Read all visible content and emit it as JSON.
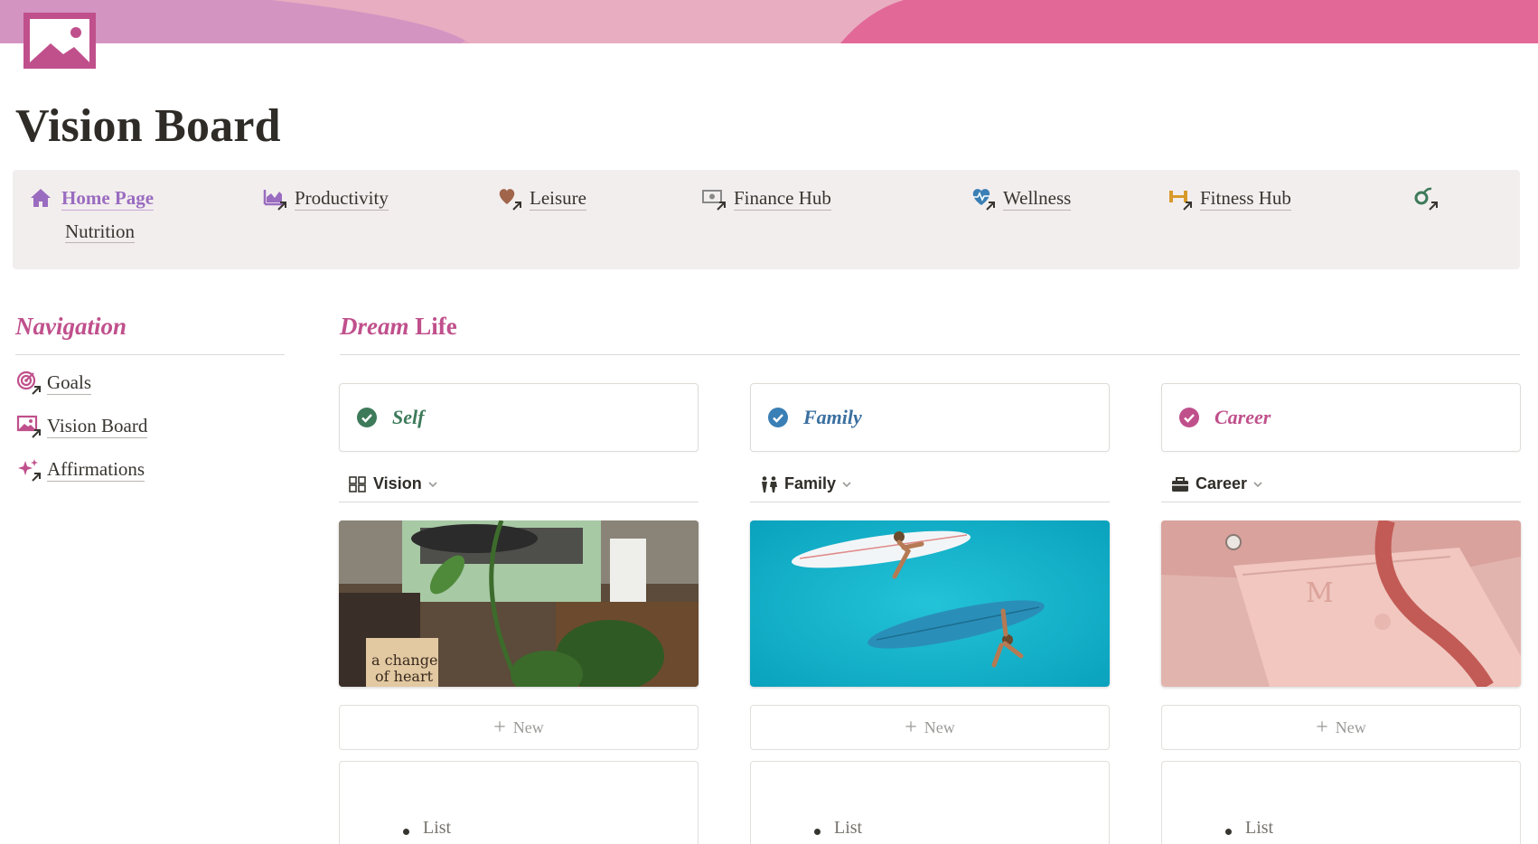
{
  "page": {
    "title": "Vision Board"
  },
  "colors": {
    "accent": "#c0508c",
    "home_link": "#9a6cc0",
    "navbar_bg": "#f3eeee"
  },
  "navbar": {
    "items": [
      {
        "label": "Home Page",
        "icon": "house-icon"
      },
      {
        "label": "Productivity",
        "icon": "chart-icon"
      },
      {
        "label": "Leisure",
        "icon": "heart-icon"
      },
      {
        "label": "Finance Hub",
        "icon": "money-icon"
      },
      {
        "label": "Wellness",
        "icon": "heart-pulse-icon"
      },
      {
        "label": "Fitness Hub",
        "icon": "dumbbell-icon"
      },
      {
        "label": "",
        "icon": "apple-icon"
      },
      {
        "label": "Nutrition",
        "icon": ""
      }
    ]
  },
  "sidebar": {
    "heading": "Navigation",
    "items": [
      {
        "label": "Goals",
        "icon": "target-icon"
      },
      {
        "label": "Vision Board",
        "icon": "image-icon"
      },
      {
        "label": "Affirmations",
        "icon": "sparkles-icon"
      }
    ]
  },
  "main": {
    "heading_italic": "Dream",
    "heading_plain": "Life",
    "columns": [
      {
        "title": "Self",
        "title_color": "#3d7a5a",
        "check_color": "#3d7a5a",
        "view": "Vision",
        "view_icon": "grid-icon",
        "new_label": "New",
        "list_item": "List",
        "photo": "record-player-plant"
      },
      {
        "title": "Family",
        "title_color": "#3a6fa0",
        "check_color": "#3a7fb5",
        "view": "Family",
        "view_icon": "people-icon",
        "new_label": "New",
        "list_item": "List",
        "photo": "surfers-ocean"
      },
      {
        "title": "Career",
        "title_color": "#c0508c",
        "check_color": "#c0508c",
        "view": "Career",
        "view_icon": "briefcase-icon",
        "new_label": "New",
        "list_item": "List",
        "photo": "pink-laptop-bag"
      }
    ]
  }
}
